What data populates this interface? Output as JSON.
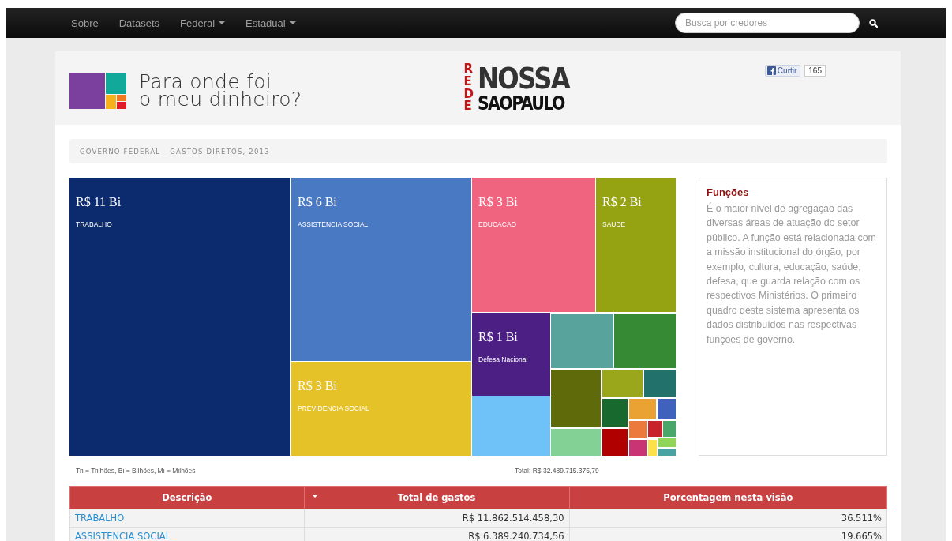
{
  "nav": {
    "items": [
      {
        "label": "Sobre",
        "dropdown": false
      },
      {
        "label": "Datasets",
        "dropdown": false
      },
      {
        "label": "Federal",
        "dropdown": true
      },
      {
        "label": "Estadual",
        "dropdown": true
      }
    ],
    "search": {
      "placeholder": "Busca por credores"
    }
  },
  "header": {
    "title_lines": [
      "Para onde foi",
      "o meu dinheiro?"
    ],
    "partner": {
      "vertical": "REDE",
      "top": "NOSSA",
      "bottom": "SAOPAULO"
    },
    "like": {
      "label": "Curtir",
      "count": "165"
    }
  },
  "breadcrumb": "GOVERNO FEDERAL - GASTOS DIRETOS, 2013",
  "treemap": {
    "tiles": [
      {
        "value": "R$ 11 Bi",
        "label": "TRABALHO",
        "color": "#0c2a6e"
      },
      {
        "value": "R$ 6 Bi",
        "label": "ASSISTENCIA SOCIAL",
        "color": "#4a79c4"
      },
      {
        "value": "R$ 3 Bi",
        "label": "PREVIDENCIA SOCIAL",
        "color": "#e6c229"
      },
      {
        "value": "R$ 3 Bi",
        "label": "EDUCACAO",
        "color": "#f06480"
      },
      {
        "value": "R$ 2 Bi",
        "label": "SAUDE",
        "color": "#95a312"
      },
      {
        "value": "R$ 1 Bi",
        "label": "Defesa Nacional",
        "color": "#4b1f84"
      },
      {
        "color": "#6ec2f7"
      },
      {
        "color": "#58a39c"
      },
      {
        "color": "#358a33"
      },
      {
        "color": "#5f6a0a"
      },
      {
        "color": "#83d195"
      },
      {
        "color": "#9aa71a"
      },
      {
        "color": "#22716b"
      },
      {
        "color": "#17692e"
      },
      {
        "color": "#eaa233"
      },
      {
        "color": "#3f62bd"
      },
      {
        "color": "#b00000"
      },
      {
        "color": "#ec7a3d"
      },
      {
        "color": "#c8222a"
      },
      {
        "color": "#4aa76a"
      },
      {
        "color": "#c93474"
      },
      {
        "color": "#fde14a"
      },
      {
        "color": "#90d65a"
      },
      {
        "color": "#4aa3a3"
      }
    ]
  },
  "info": {
    "title": "Funções",
    "text": "É o maior nível de agregação das diversas áreas de atuação do setor público. A função está relacionada com a missão institucional do órgão, por exemplo, cultura, educação, saúde, defesa, que guarda relação com os respectivos Ministérios. O primeiro quadro deste sistema apresenta os dados distribuídos nas respectivas funções de governo."
  },
  "legend": "Tri = Trilhões, Bi = Bilhões, Mi = Milhões",
  "total": "Total: R$ 32.489.715.375,79",
  "table": {
    "columns": [
      {
        "label": "Descrição",
        "sorted": false
      },
      {
        "label": "Total de gastos",
        "sorted": true
      },
      {
        "label": "Porcentagem nesta visão",
        "sorted": false
      }
    ],
    "rows": [
      [
        "TRABALHO",
        "R$ 11.862.514.458,30",
        "36.511%"
      ],
      [
        "ASSISTENCIA SOCIAL",
        "R$ 6.389.240.734,56",
        "19.665%"
      ]
    ]
  }
}
